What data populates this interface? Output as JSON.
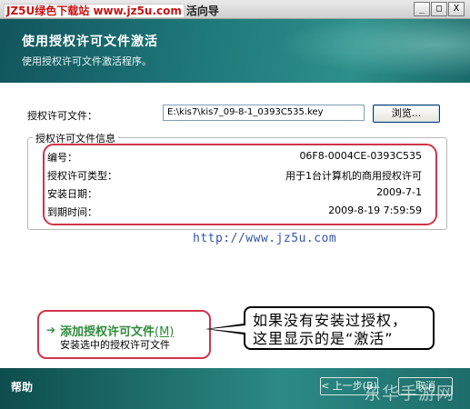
{
  "window": {
    "title_logo": "JZ5U绿色下载站 www.jz5u.com",
    "title_rest": "活向导",
    "buttons": [
      "_",
      "□",
      "X"
    ]
  },
  "header": {
    "title": "使用授权许可文件激活",
    "subtitle": "使用授权许可文件激活程序。"
  },
  "file_row": {
    "label": "授权许可文件：",
    "value": "E:\\kis7\\kis7_09-8-1_0393C535.key",
    "browse_label": "浏览..."
  },
  "info_group": {
    "legend": "授权许可文件信息",
    "rows": [
      {
        "key": "编号：",
        "value": "06F8-0004CE-0393C535"
      },
      {
        "key": "授权许可类型：",
        "value": "用于1台计算机的商用授权许可"
      },
      {
        "key": "安装日期：",
        "value": "2009-7-1"
      },
      {
        "key": "到期时间：",
        "value": "2009-8-19 7:59:59"
      }
    ]
  },
  "watermark": "http://www.jz5u.com",
  "add_license": {
    "label": "添加授权许可文件",
    "mnemonic": "(M)",
    "sublabel": "安装选中的授权许可文件"
  },
  "callout": {
    "line1": "如果没有安装过授权，",
    "line2": "这里显示的是“激活”"
  },
  "footer": {
    "help": "帮助",
    "prev": "< 上一步(B)",
    "cancel": "取消",
    "watermark": "东华手游网"
  },
  "colors": {
    "header": "#1f7a7c",
    "accent_green": "#2e8b3a",
    "highlight_red": "#d0354a"
  }
}
